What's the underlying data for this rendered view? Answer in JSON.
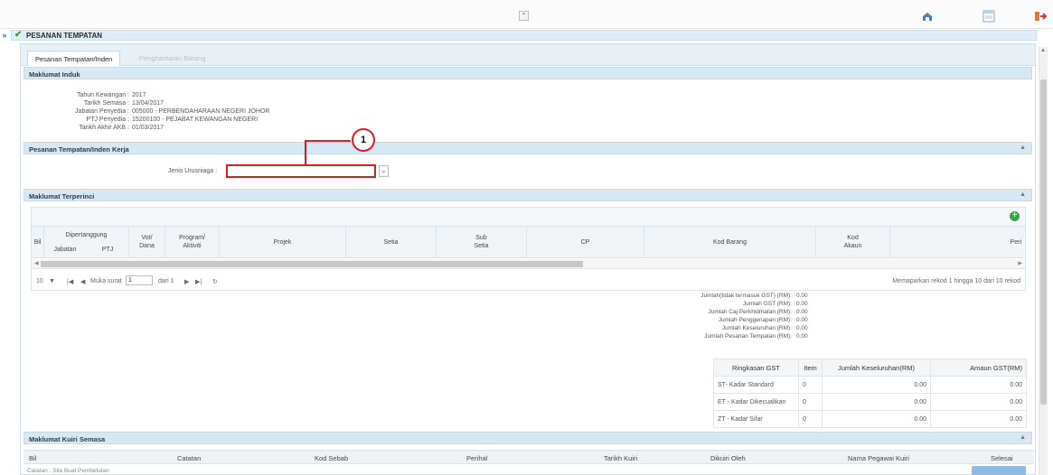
{
  "header": {
    "title": "PESANAN TEMPATAN"
  },
  "tabs": [
    {
      "label": "Pesanan Tempatan/Inden"
    },
    {
      "label": "Penghantaran Barang"
    }
  ],
  "maklumat_induk": {
    "heading": "Maklumat Induk",
    "fields": [
      {
        "label": "Tahun Kewangan :",
        "value": "2017"
      },
      {
        "label": "Tarikh Semasa :",
        "value": "13/04/2017"
      },
      {
        "label": "Jabatan Penyedia :",
        "value": "005000 - PERBENDAHARAAN NEGERI JOHOR"
      },
      {
        "label": "PTJ Penyedia :",
        "value": "15200100 - PEJABAT KEWANGAN NEGERI"
      },
      {
        "label": "Tarikh Akhir AKB :",
        "value": "01/03/2017"
      }
    ]
  },
  "pesanan_kerja": {
    "heading": "Pesanan Tempatan/Inden Kerja",
    "jenis_label": "Jenis Urusniaga :",
    "jenis_value": "",
    "callout": "1"
  },
  "terperinci": {
    "heading": "Maklumat Terperinci",
    "columns": {
      "bil": "Bil",
      "dipertanggung": "Dipertanggung",
      "jabatan": "Jabatan",
      "ptj": "PTJ",
      "vot1": "Vot/",
      "vot2": "Dana",
      "prog1": "Program/",
      "prog2": "Aktiviti",
      "projek": "Projek",
      "setia": "Setia",
      "sub1": "Sub",
      "sub2": "Setia",
      "cp": "CP",
      "kod_barang": "Kod Barang",
      "kod1": "Kod",
      "kod2": "Akaun",
      "peri": "Peri"
    },
    "pager": {
      "per_page": "10",
      "muka_surat": "Muka surat",
      "page": "1",
      "dari": "dari 1",
      "record_text": "Memaparkan rekod 1 hingga 10 dari 10 rekod"
    }
  },
  "summary": [
    {
      "label": "Jumlah(tidak termasuk GST) (RM):",
      "value": "0.00"
    },
    {
      "label": "Jumlah GST (RM):",
      "value": "0.00"
    },
    {
      "label": "Jumlah Caj Perkhidmatan (RM):",
      "value": "0.00"
    },
    {
      "label": "Jumlah Penggenapan (RM):",
      "value": "0.00"
    },
    {
      "label": "Jumlah Keseluruhan (RM):",
      "value": "0.00"
    },
    {
      "label": "Jumlah Pesanan Tempatan (RM):",
      "value": "0.00"
    }
  ],
  "gst_table": {
    "headers": [
      "Ringkasan GST",
      "Item",
      "Jumlah Keseluruhan(RM)",
      "Amaun GST(RM)"
    ],
    "rows": [
      [
        "ST- Kadar Standard",
        "0",
        "0.00",
        "0.00"
      ],
      [
        "ET - Kadar Dikecualikan",
        "0",
        "0.00",
        "0.00"
      ],
      [
        "ZT - Kadar Sifar",
        "0",
        "0.00",
        "0.00"
      ]
    ]
  },
  "kuiri": {
    "heading": "Maklumat Kuiri Semasa",
    "columns": [
      "Bil",
      "Catatan",
      "Kod Sebab",
      "Perihal",
      "Tarikh Kuiri",
      "Dikuiri Oleh",
      "Nama Pegawai Kuiri",
      "Selesai"
    ],
    "footnote": "Catatan : Sila Buat Pembetulan"
  },
  "colors": {
    "accent_red": "#d81f26",
    "header_blue": "#d8e8f2",
    "add_green": "#35a44a"
  }
}
